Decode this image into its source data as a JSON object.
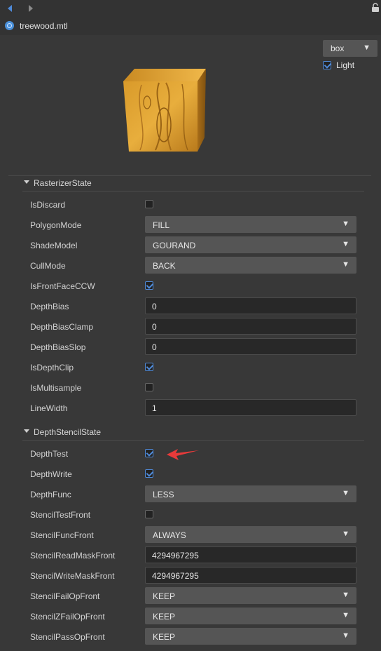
{
  "nav": {
    "back": "back-arrow",
    "forward": "forward-arrow"
  },
  "file": {
    "title": "treewood.mtl"
  },
  "preview": {
    "model_select": "box",
    "light_label": "Light",
    "light_checked": true
  },
  "rasterizer": {
    "title": "RasterizerState",
    "rows": [
      {
        "label": "IsDiscard",
        "type": "check",
        "value": false
      },
      {
        "label": "PolygonMode",
        "type": "dropdown",
        "value": "FILL"
      },
      {
        "label": "ShadeModel",
        "type": "dropdown",
        "value": "GOURAND"
      },
      {
        "label": "CullMode",
        "type": "dropdown",
        "value": "BACK"
      },
      {
        "label": "IsFrontFaceCCW",
        "type": "check",
        "value": true
      },
      {
        "label": "DepthBias",
        "type": "text",
        "value": "0"
      },
      {
        "label": "DepthBiasClamp",
        "type": "text",
        "value": "0"
      },
      {
        "label": "DepthBiasSlop",
        "type": "text",
        "value": "0"
      },
      {
        "label": "IsDepthClip",
        "type": "check",
        "value": true
      },
      {
        "label": "IsMultisample",
        "type": "check",
        "value": false
      },
      {
        "label": "LineWidth",
        "type": "text",
        "value": "1"
      }
    ]
  },
  "depthstencil": {
    "title": "DepthStencilState",
    "rows": [
      {
        "label": "DepthTest",
        "type": "check",
        "value": true
      },
      {
        "label": "DepthWrite",
        "type": "check",
        "value": true
      },
      {
        "label": "DepthFunc",
        "type": "dropdown",
        "value": "LESS"
      },
      {
        "label": "StencilTestFront",
        "type": "check",
        "value": false
      },
      {
        "label": "StencilFuncFront",
        "type": "dropdown",
        "value": "ALWAYS"
      },
      {
        "label": "StencilReadMaskFront",
        "type": "text",
        "value": "4294967295"
      },
      {
        "label": "StencilWriteMaskFront",
        "type": "text",
        "value": "4294967295"
      },
      {
        "label": "StencilFailOpFront",
        "type": "dropdown",
        "value": "KEEP"
      },
      {
        "label": "StencilZFailOpFront",
        "type": "dropdown",
        "value": "KEEP"
      },
      {
        "label": "StencilPassOpFront",
        "type": "dropdown",
        "value": "KEEP"
      }
    ]
  },
  "colors": {
    "accent": "#4f8ad8",
    "annotation_arrow": "#e83a3a"
  }
}
